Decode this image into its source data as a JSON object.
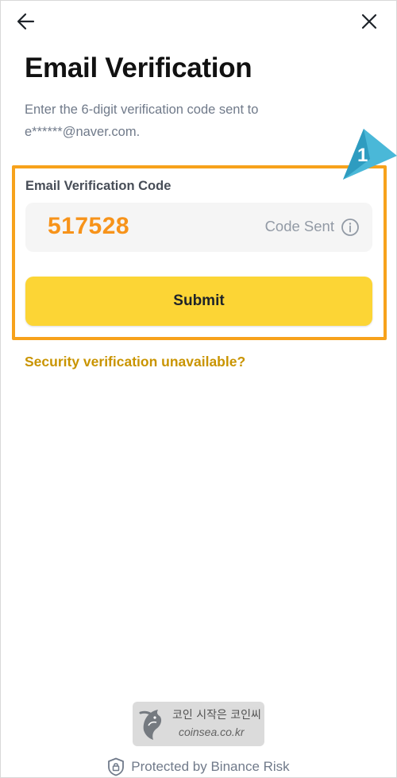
{
  "header": {
    "back_icon": "arrow-left-icon",
    "close_icon": "close-icon"
  },
  "page": {
    "title": "Email Verification",
    "subtitle_line1": "Enter the 6-digit verification code sent to",
    "subtitle_line2": "e******@naver.com."
  },
  "annotation": {
    "number": "1",
    "highlight_color": "#f7a21b",
    "pointer_color": "#4ab8d8"
  },
  "form": {
    "field_label": "Email Verification Code",
    "code_value": "517528",
    "code_status": "Code Sent",
    "info_icon": "info-circle-icon",
    "submit_label": "Submit",
    "security_link": "Security verification unavailable?"
  },
  "watermark": {
    "line1": "코인 시작은 코인씨",
    "line2": "coinsea.co.kr"
  },
  "footer": {
    "icon": "shield-lock-icon",
    "text": "Protected by Binance Risk"
  },
  "colors": {
    "accent_yellow": "#fcd535",
    "code_orange": "#f7931a",
    "link_gold": "#c99400",
    "text_dark": "#111111",
    "text_gray": "#707a8a"
  }
}
